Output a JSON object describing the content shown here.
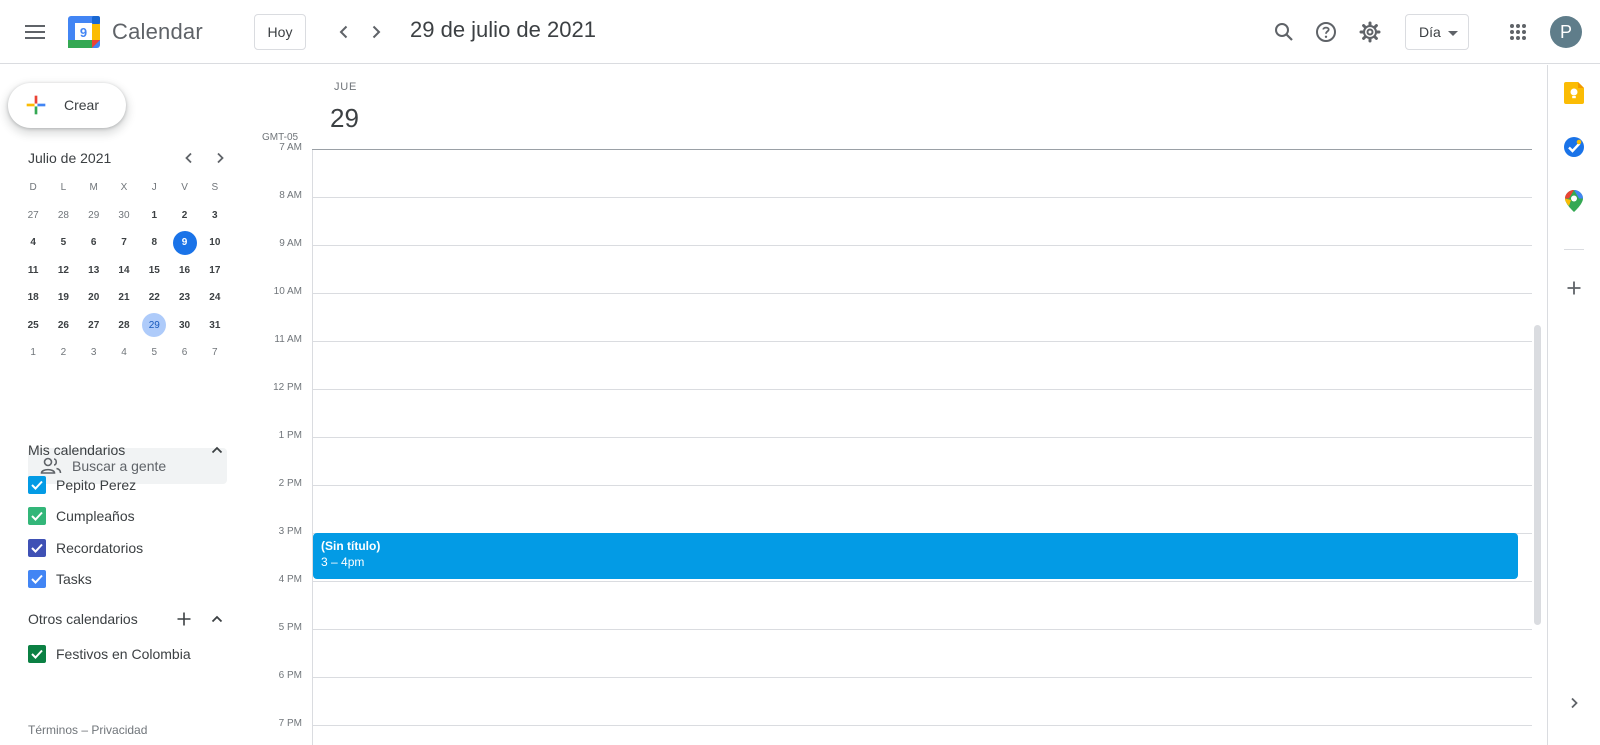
{
  "header": {
    "app_name": "Calendar",
    "logo_day": "9",
    "today_label": "Hoy",
    "date_title": "29 de julio de 2021",
    "view_label": "Día",
    "avatar_initial": "P"
  },
  "sidebar": {
    "create_label": "Crear",
    "mini_calendar": {
      "month_title": "Julio de 2021",
      "weekdays": [
        "D",
        "L",
        "M",
        "X",
        "J",
        "V",
        "S"
      ],
      "weeks": [
        [
          "27",
          "28",
          "29",
          "30",
          "1",
          "2",
          "3"
        ],
        [
          "4",
          "5",
          "6",
          "7",
          "8",
          "9",
          "10"
        ],
        [
          "11",
          "12",
          "13",
          "14",
          "15",
          "16",
          "17"
        ],
        [
          "18",
          "19",
          "20",
          "21",
          "22",
          "23",
          "24"
        ],
        [
          "25",
          "26",
          "27",
          "28",
          "29",
          "30",
          "31"
        ],
        [
          "1",
          "2",
          "3",
          "4",
          "5",
          "6",
          "7"
        ]
      ],
      "today": "9",
      "selected": "29"
    },
    "search_people_placeholder": "Buscar a gente",
    "my_calendars_title": "Mis calendarios",
    "my_calendars": [
      {
        "name": "Pepito Perez",
        "color": "#039be5"
      },
      {
        "name": "Cumpleaños",
        "color": "#33b679"
      },
      {
        "name": "Recordatorios",
        "color": "#3f51b5"
      },
      {
        "name": "Tasks",
        "color": "#4285f4"
      }
    ],
    "other_calendars_title": "Otros calendarios",
    "other_calendars": [
      {
        "name": "Festivos en Colombia",
        "color": "#0b8043"
      }
    ],
    "footer": "Términos – Privacidad"
  },
  "day_view": {
    "weekday": "JUE",
    "day_number": "29",
    "timezone": "GMT-05",
    "hours": [
      "7 AM",
      "8 AM",
      "9 AM",
      "10 AM",
      "11 AM",
      "12 PM",
      "1 PM",
      "2 PM",
      "3 PM",
      "4 PM",
      "5 PM",
      "6 PM",
      "7 PM"
    ],
    "events": [
      {
        "title": "(Sin título)",
        "time": "3 – 4pm",
        "color": "#039be5"
      }
    ]
  },
  "side_panel": {
    "icons": [
      "keep-icon",
      "tasks-icon",
      "maps-icon",
      "add-icon",
      "expand-icon"
    ]
  }
}
